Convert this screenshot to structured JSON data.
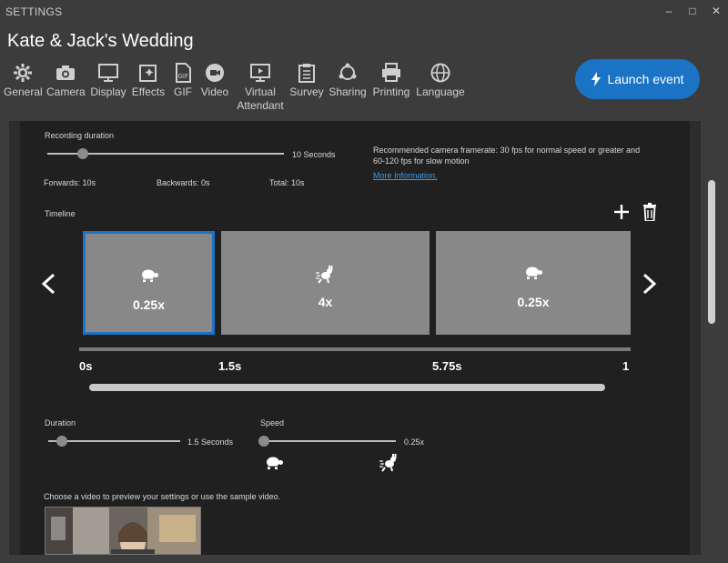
{
  "window": {
    "title": "SETTINGS",
    "minimize": "–",
    "maximize": "□",
    "close": "✕"
  },
  "event_title": "Kate & Jack's Wedding",
  "toolbar": {
    "items": [
      {
        "label": "General",
        "icon": "gear-icon"
      },
      {
        "label": "Camera",
        "icon": "camera-icon"
      },
      {
        "label": "Display",
        "icon": "monitor-icon"
      },
      {
        "label": "Effects",
        "icon": "effects-icon"
      },
      {
        "label": "GIF",
        "icon": "gif-file-icon"
      },
      {
        "label": "Video",
        "icon": "video-icon"
      },
      {
        "label": "Virtual",
        "label2": "Attendant",
        "icon": "virtual-attendant-icon"
      },
      {
        "label": "Survey",
        "icon": "clipboard-icon"
      },
      {
        "label": "Sharing",
        "icon": "share-icon"
      },
      {
        "label": "Printing",
        "icon": "printer-icon"
      },
      {
        "label": "Language",
        "icon": "globe-icon"
      }
    ],
    "launch_label": "Launch event"
  },
  "recording": {
    "label": "Recording duration",
    "value_label": "10 Seconds",
    "value_fraction": 0.15,
    "forwards": "Forwards: 10s",
    "backwards": "Backwards: 0s",
    "total": "Total: 10s",
    "recommendation": "Recommended camera framerate: 30 fps for normal speed or greater and",
    "recommendation2": "60-120 fps for slow motion",
    "more_info": "More Information."
  },
  "timeline": {
    "label": "Timeline",
    "clips": [
      {
        "speed": "0.25x",
        "icon": "turtle-icon",
        "selected": true
      },
      {
        "speed": "4x",
        "icon": "rabbit-icon",
        "selected": false
      },
      {
        "speed": "0.25x",
        "icon": "turtle-icon",
        "selected": false
      }
    ],
    "ticks": [
      "0s",
      "1.5s",
      "5.75s",
      "1"
    ]
  },
  "duration": {
    "label": "Duration",
    "value_label": "1.5 Seconds",
    "value_fraction": 0.1
  },
  "speed": {
    "label": "Speed",
    "value_label": "0.25x",
    "value_fraction": 0.0
  },
  "preview": {
    "text": "Choose a video to preview your settings or use the sample video."
  },
  "colors": {
    "accent": "#1b73c5",
    "panel": "#202020",
    "background": "#3c3c3c"
  }
}
